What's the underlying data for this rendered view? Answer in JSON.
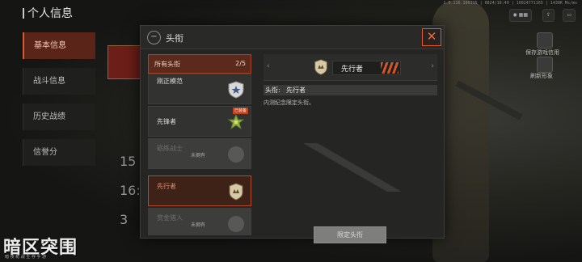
{
  "page": {
    "title": "个人信息",
    "status_text": "1.0.116.106115 | 0824/16:49 | 10024771165 | 1430K Ms/ms"
  },
  "side_menu": {
    "items": [
      {
        "label": "基本信息",
        "active": true
      },
      {
        "label": "战斗信息",
        "active": false
      },
      {
        "label": "历史战绩",
        "active": false
      },
      {
        "label": "信誉分",
        "active": false
      }
    ]
  },
  "side_stats": [
    "15",
    "16:",
    "3"
  ],
  "right_panel": {
    "save_label": "保存游戏信用",
    "refresh_label": "刷新形象"
  },
  "modal": {
    "title": "头衔",
    "close_icon": "close-icon",
    "back_icon": "back-icon",
    "list_header": {
      "label": "所有头衔",
      "count": "2/5"
    },
    "titles": [
      {
        "name": "刚正模范",
        "status": "",
        "locked": false,
        "selected": false,
        "badge": "shield-star-icon"
      },
      {
        "name": "先锋者",
        "status": "",
        "tag": "已装备",
        "locked": false,
        "selected": false,
        "badge": "green-star-icon"
      },
      {
        "name": "砺练战士",
        "status": "未拥有",
        "locked": true,
        "selected": false,
        "badge": "locked-badge-icon"
      },
      {
        "name": "先行者",
        "status": "",
        "locked": false,
        "selected": true,
        "badge": "hands-badge-icon"
      },
      {
        "name": "赏金猎人",
        "status": "未拥有",
        "locked": true,
        "selected": false,
        "badge": "locked-badge-icon"
      }
    ],
    "detail": {
      "title_name": "先行者",
      "prev_arrow": "‹",
      "next_arrow": "›",
      "info_label": "头衔:",
      "info_value": "先行者",
      "description": "内测纪念限定头衔。",
      "button_label": "限定头衔"
    }
  },
  "logo": {
    "text": "暗区突围",
    "subtitle": "暗 夜 枪 战 生 存 手 游"
  },
  "colors": {
    "accent": "#e05a2a",
    "selected_bg": "#3e2218",
    "panel_bg": "#252624"
  }
}
